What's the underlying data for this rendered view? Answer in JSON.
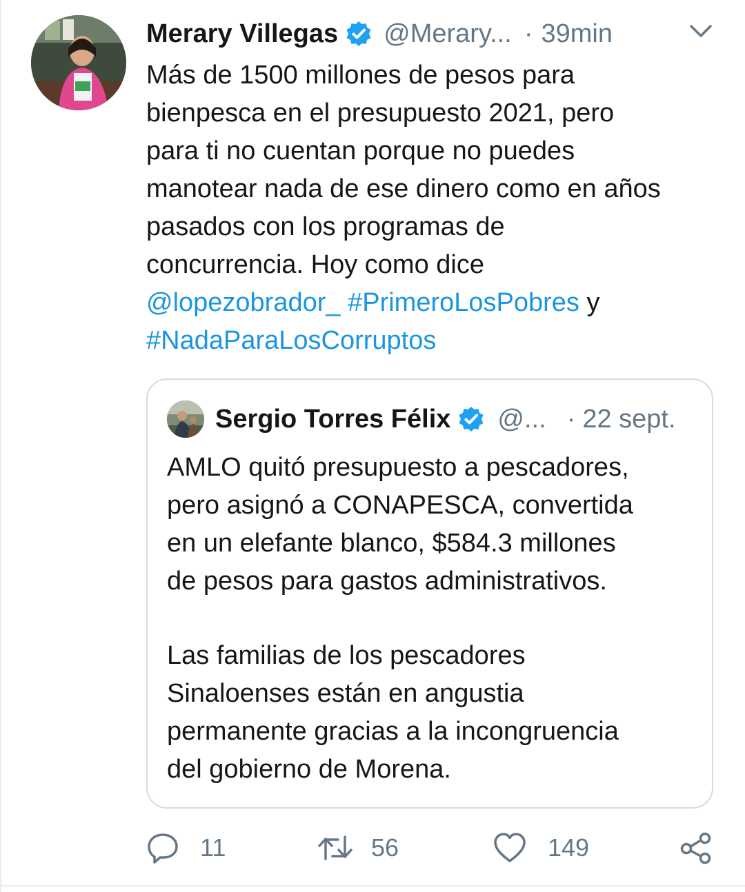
{
  "tweet": {
    "author_name": "Merary Villegas",
    "author_handle": "@Merary...",
    "separator": "·",
    "time": "39min",
    "text_lines": [
      "Más de 1500 millones de pesos para",
      "bienpesca en el presupuesto 2021, pero",
      "para ti no cuentan porque no puedes",
      "manotear nada de ese dinero como en años",
      "pasados con los programas de",
      "concurrencia. Hoy como dice"
    ],
    "mention": "@lopezobrador_",
    "hashtag_1": "#PrimeroLosPobres",
    "conjunction": "y",
    "hashtag_2": "#NadaParaLosCorruptos"
  },
  "quoted": {
    "author_name": "Sergio Torres Félix",
    "author_handle": "@...",
    "separator": "·",
    "time": "22 sept.",
    "paragraph_1": [
      "AMLO quitó presupuesto a pescadores,",
      "pero asignó a CONAPESCA, convertida",
      "en un elefante blanco, $584.3 millones",
      "de pesos para gastos administrativos."
    ],
    "paragraph_2": [
      "Las familias de los pescadores",
      "Sinaloenses están en angustia",
      "permanente gracias a la incongruencia",
      "del gobierno de Morena."
    ]
  },
  "actions": {
    "reply_count": "11",
    "retweet_count": "56",
    "like_count": "149"
  },
  "icons": {
    "verified": "verified-badge-icon",
    "caret": "chevron-down-icon",
    "reply": "reply-icon",
    "retweet": "retweet-icon",
    "like": "heart-icon",
    "share": "share-icon"
  },
  "colors": {
    "link": "#1b95e0",
    "muted": "#657786",
    "text": "#14171a",
    "verified": "#1da1f2",
    "border": "#d4dce3"
  }
}
